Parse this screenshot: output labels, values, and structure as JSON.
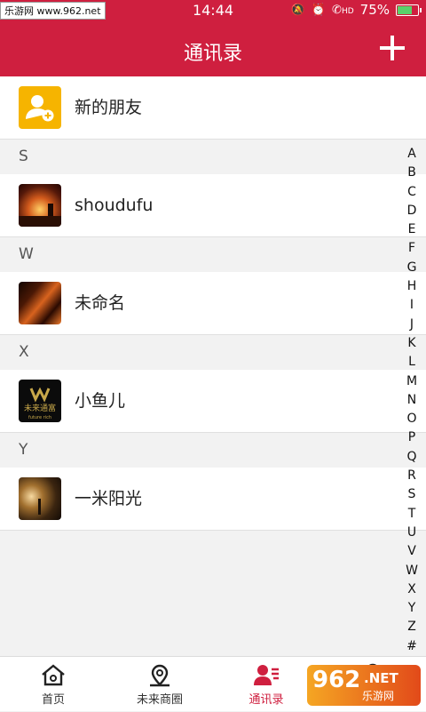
{
  "status_bar": {
    "watermark": "乐游网 www.962.net",
    "time": "14:44",
    "signal_icons": [
      "alarm-icon",
      "clock-icon",
      "hd-call-icon"
    ],
    "hd": "HD",
    "battery_percent": "75%",
    "battery_level": 0.75,
    "battery_color": "#5ad16a"
  },
  "header": {
    "title": "通讯录",
    "add_icon": "plus-icon",
    "color": "#cf1f3f"
  },
  "new_friend": {
    "label": "新的朋友",
    "icon": "add-person-icon",
    "color": "#f6b400"
  },
  "sections": [
    {
      "letter": "S",
      "contacts": [
        {
          "name": "shoudufu"
        }
      ]
    },
    {
      "letter": "W",
      "contacts": [
        {
          "name": "未命名"
        }
      ]
    },
    {
      "letter": "X",
      "contacts": [
        {
          "name": "小鱼儿",
          "avatar_text": "未来通富",
          "avatar_subtext": "future rich"
        }
      ]
    },
    {
      "letter": "Y",
      "contacts": [
        {
          "name": "一米阳光"
        }
      ]
    }
  ],
  "alphabet_index": [
    "A",
    "B",
    "C",
    "D",
    "E",
    "F",
    "G",
    "H",
    "I",
    "J",
    "K",
    "L",
    "M",
    "N",
    "O",
    "P",
    "Q",
    "R",
    "S",
    "T",
    "U",
    "V",
    "W",
    "X",
    "Y",
    "Z",
    "#"
  ],
  "tabbar": {
    "tabs": [
      {
        "label": "首页",
        "icon": "home-icon"
      },
      {
        "label": "未来商圈",
        "icon": "location-pin-icon"
      },
      {
        "label": "通讯录",
        "icon": "contacts-icon",
        "active": true
      },
      {
        "label": "",
        "icon": "person-icon"
      }
    ],
    "watermark_big": "962",
    "watermark_net": ".NET",
    "watermark_small": "乐游网"
  }
}
